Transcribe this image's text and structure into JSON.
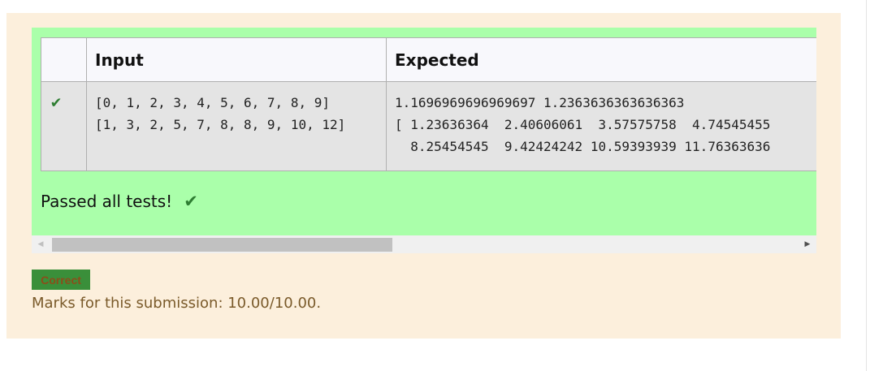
{
  "results_table": {
    "headers": [
      "",
      "Input",
      "Expected"
    ],
    "rows": [
      {
        "status_icon": "check-icon",
        "input": "[0, 1, 2, 3, 4, 5, 6, 7, 8, 9]\n[1, 3, 2, 5, 7, 8, 8, 9, 10, 12]",
        "expected": "1.1696969696969697 1.2363636363636363\n[ 1.23636364  2.40606061  3.57575758  4.74545455\n  8.25454545  9.42424242 10.59393939 11.76363636"
      }
    ]
  },
  "summary": {
    "passed_text": "Passed all tests!",
    "icon": "check-icon"
  },
  "outcome": {
    "badge_label": "Correct",
    "marks_text": "Marks for this submission: 10.00/10.00."
  },
  "colors": {
    "panel_bg": "#fcefdc",
    "pass_bg": "#aaffaa",
    "check": "#2e7d32",
    "badge_bg": "#3a8f3a"
  }
}
